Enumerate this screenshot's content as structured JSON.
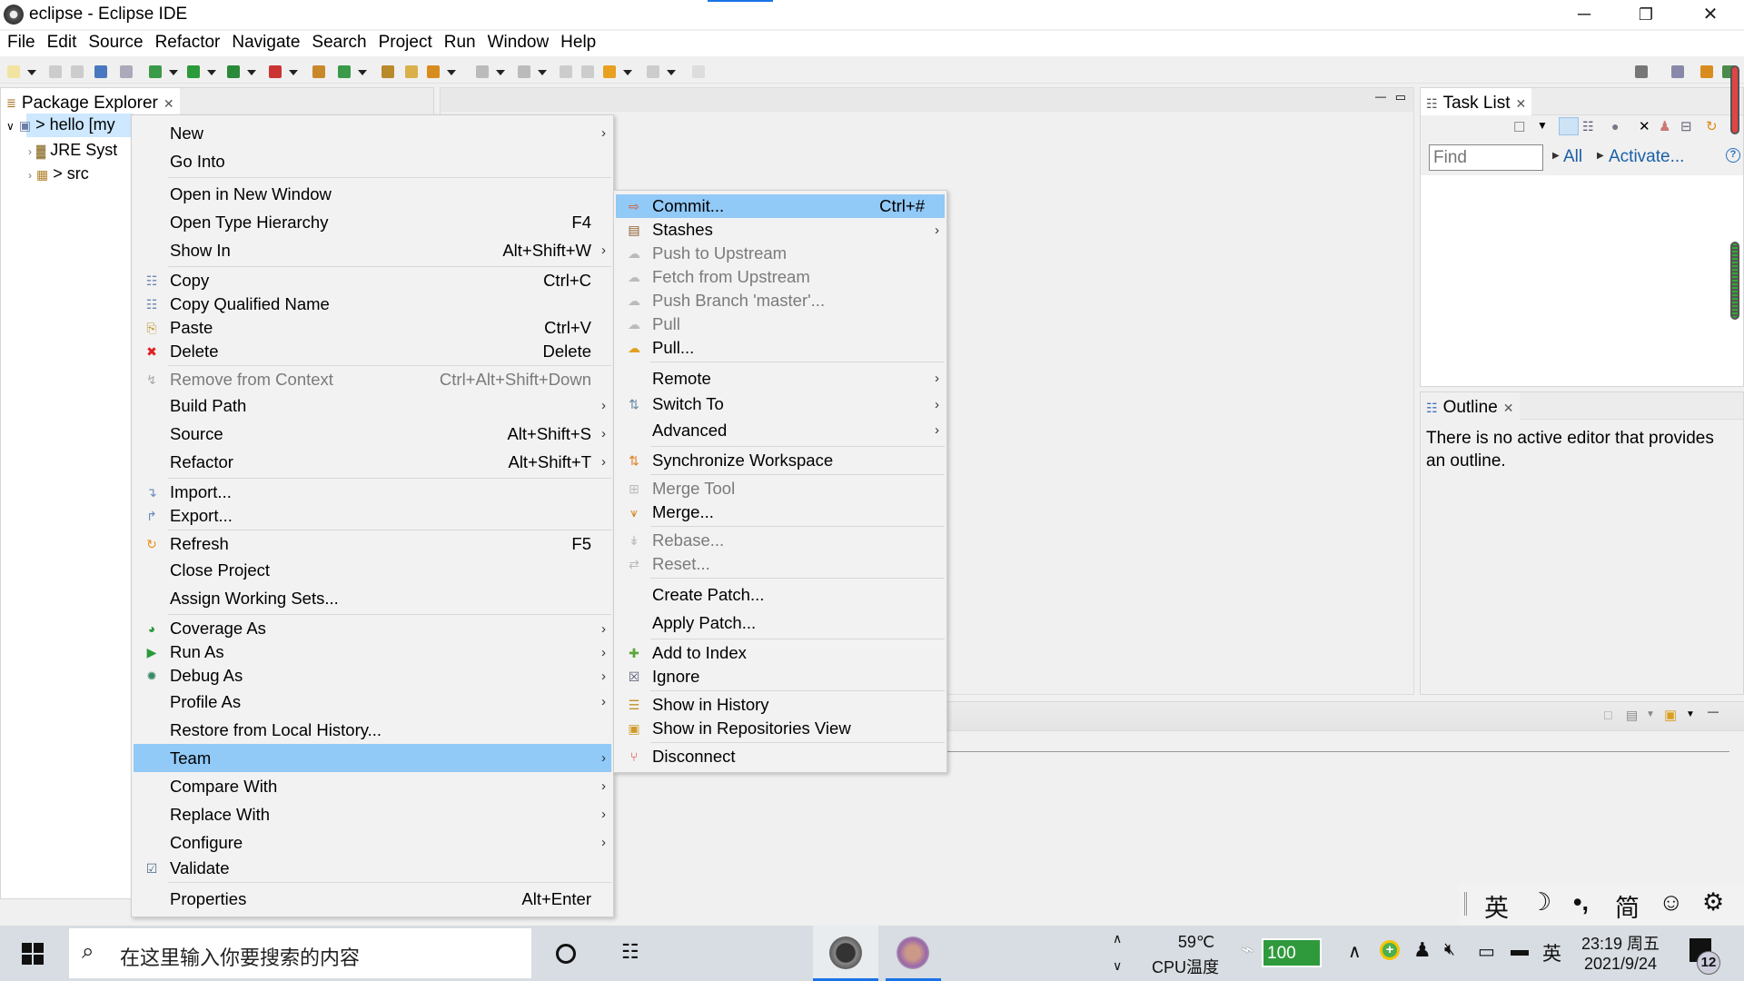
{
  "window": {
    "title": "eclipse - Eclipse IDE",
    "controls": [
      "minimize-icon",
      "restore-icon",
      "close-icon"
    ]
  },
  "menubar": [
    "File",
    "Edit",
    "Source",
    "Refactor",
    "Navigate",
    "Search",
    "Project",
    "Run",
    "Window",
    "Help"
  ],
  "package_explorer": {
    "tab_label": "Package Explorer",
    "tree": [
      {
        "label": "> hello [my",
        "expanded": true,
        "selected": true
      },
      {
        "label": "JRE Syst",
        "expanded": false
      },
      {
        "label": "> src",
        "expanded": false
      }
    ]
  },
  "context_menu": [
    {
      "label": "New",
      "submenu": true
    },
    {
      "label": "Go Into"
    },
    {
      "sep": true
    },
    {
      "label": "Open in New Window"
    },
    {
      "label": "Open Type Hierarchy",
      "shortcut": "F4"
    },
    {
      "label": "Show In",
      "shortcut": "Alt+Shift+W",
      "submenu": true
    },
    {
      "sep": true
    },
    {
      "label": "Copy",
      "shortcut": "Ctrl+C",
      "icon": "copy-icon"
    },
    {
      "label": "Copy Qualified Name",
      "icon": "copy-qualified-icon"
    },
    {
      "label": "Paste",
      "shortcut": "Ctrl+V",
      "icon": "paste-icon"
    },
    {
      "label": "Delete",
      "shortcut": "Delete",
      "icon": "delete-icon"
    },
    {
      "sep": true
    },
    {
      "label": "Remove from Context",
      "shortcut": "Ctrl+Alt+Shift+Down",
      "disabled": true,
      "icon": "remove-context-icon"
    },
    {
      "label": "Build Path",
      "submenu": true
    },
    {
      "label": "Source",
      "shortcut": "Alt+Shift+S",
      "submenu": true
    },
    {
      "label": "Refactor",
      "shortcut": "Alt+Shift+T",
      "submenu": true
    },
    {
      "sep": true
    },
    {
      "label": "Import...",
      "icon": "import-icon"
    },
    {
      "label": "Export...",
      "icon": "export-icon"
    },
    {
      "sep": true
    },
    {
      "label": "Refresh",
      "shortcut": "F5",
      "icon": "refresh-icon"
    },
    {
      "label": "Close Project"
    },
    {
      "label": "Assign Working Sets..."
    },
    {
      "sep": true
    },
    {
      "label": "Coverage As",
      "submenu": true,
      "icon": "coverage-icon"
    },
    {
      "label": "Run As",
      "submenu": true,
      "icon": "run-icon"
    },
    {
      "label": "Debug As",
      "submenu": true,
      "icon": "debug-icon"
    },
    {
      "label": "Profile As",
      "submenu": true
    },
    {
      "label": "Restore from Local History..."
    },
    {
      "label": "Team",
      "submenu": true,
      "selected": true
    },
    {
      "label": "Compare With",
      "submenu": true
    },
    {
      "label": "Replace With",
      "submenu": true
    },
    {
      "label": "Configure",
      "submenu": true
    },
    {
      "label": "Validate",
      "icon": "checkbox-checked-icon"
    },
    {
      "sep": true
    },
    {
      "label": "Properties",
      "shortcut": "Alt+Enter"
    }
  ],
  "team_menu": [
    {
      "label": "Commit...",
      "shortcut": "Ctrl+#",
      "icon": "commit-icon",
      "selected": true
    },
    {
      "label": "Stashes",
      "submenu": true,
      "icon": "stashes-icon"
    },
    {
      "label": "Push to Upstream",
      "disabled": true,
      "icon": "push-icon"
    },
    {
      "label": "Fetch from Upstream",
      "disabled": true,
      "icon": "fetch-icon"
    },
    {
      "label": "Push Branch 'master'...",
      "disabled": true,
      "icon": "push-branch-icon"
    },
    {
      "label": "Pull",
      "disabled": true,
      "icon": "pull-icon"
    },
    {
      "label": "Pull...",
      "icon": "pull-dialog-icon"
    },
    {
      "sep": true
    },
    {
      "label": "Remote",
      "submenu": true
    },
    {
      "label": "Switch To",
      "submenu": true,
      "icon": "switch-branch-icon"
    },
    {
      "label": "Advanced",
      "submenu": true
    },
    {
      "sep": true
    },
    {
      "label": "Synchronize Workspace",
      "icon": "synchronize-icon"
    },
    {
      "sep": true
    },
    {
      "label": "Merge Tool",
      "disabled": true,
      "icon": "merge-tool-icon"
    },
    {
      "label": "Merge...",
      "icon": "merge-icon"
    },
    {
      "sep": true
    },
    {
      "label": "Rebase...",
      "disabled": true,
      "icon": "rebase-icon"
    },
    {
      "label": "Reset...",
      "disabled": true,
      "icon": "reset-icon"
    },
    {
      "sep": true
    },
    {
      "label": "Create Patch..."
    },
    {
      "label": "Apply Patch..."
    },
    {
      "sep": true
    },
    {
      "label": "Add to Index",
      "icon": "add-icon"
    },
    {
      "label": "Ignore",
      "icon": "ignore-icon"
    },
    {
      "sep": true
    },
    {
      "label": "Show in History",
      "icon": "history-icon"
    },
    {
      "label": "Show in Repositories View",
      "icon": "git-repo-icon"
    },
    {
      "sep": true
    },
    {
      "label": "Disconnect",
      "icon": "disconnect-icon"
    }
  ],
  "task_list": {
    "tab_label": "Task List",
    "find_placeholder": "Find",
    "all_link": "All",
    "activate_link": "Activate..."
  },
  "outline": {
    "tab_label": "Outline",
    "message": "There is no active editor that provides an outline."
  },
  "ime_bar": [
    "英",
    "☽",
    "•,",
    "简",
    "☺",
    "⚙"
  ],
  "taskbar": {
    "search_placeholder": "在这里输入你要搜索的内容",
    "cpu_temp": "59℃",
    "cpu_label": "CPU温度",
    "battery": "100",
    "ime": "英",
    "time": "23:19 周五",
    "date": "2021/9/24",
    "notifications": "12"
  },
  "colors": {
    "selection": "#91c9f7",
    "link": "#1a5fa8",
    "taskbar": "#d7dde2"
  }
}
